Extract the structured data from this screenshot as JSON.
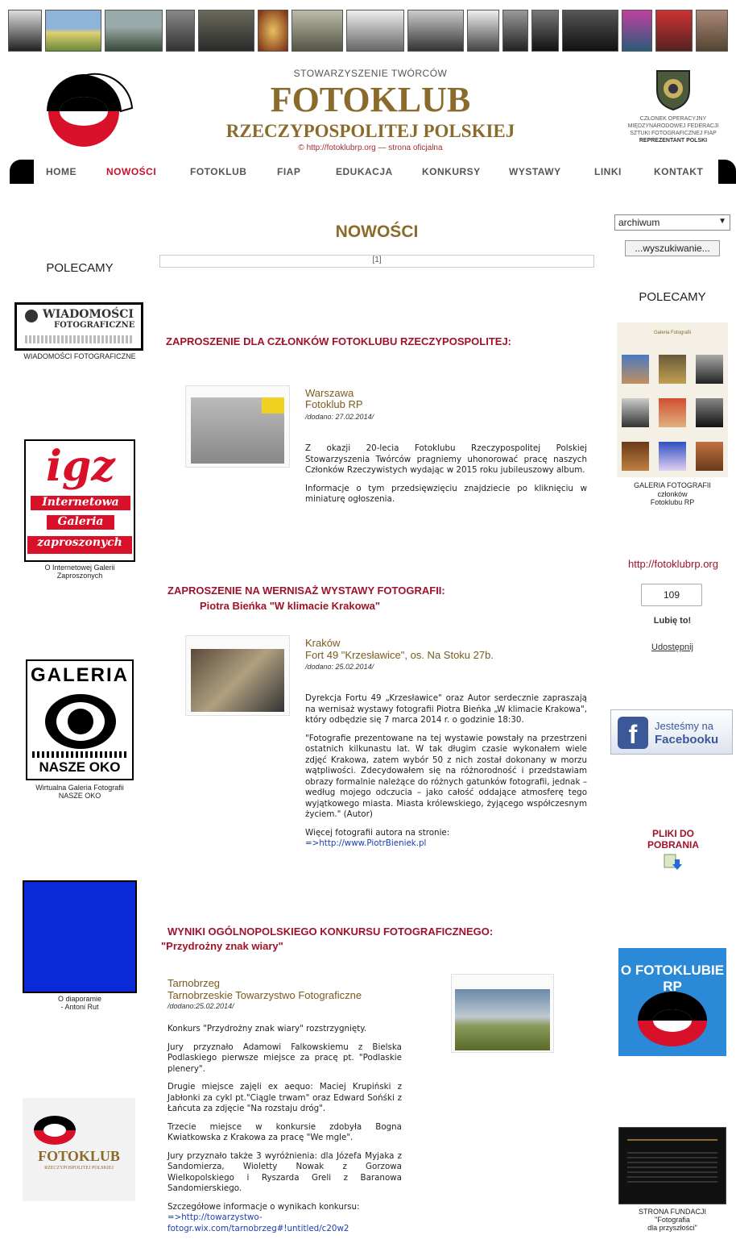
{
  "header": {
    "subtitle": "STOWARZYSZENIE TWÓRCÓW",
    "title": "FOTOKLUB",
    "title2": "RZECZYPOSPOLITEJ POLSKIEJ",
    "url_note": "© http://fotoklubrp.org — strona oficjalna",
    "fiap_line1": "CZŁONEK OPERACYJNY",
    "fiap_line2": "MIĘDZYNARODOWEJ FEDERACJI",
    "fiap_line3": "SZTUKI FOTOGRAFICZNEJ FIAP",
    "fiap_line4": "REPREZENTANT POLSKI"
  },
  "nav": {
    "items": [
      "HOME",
      "NOWOŚCI",
      "FOTOKLUB",
      "FIAP",
      "EDUKACJA",
      "KONKURSY",
      "WYSTAWY",
      "LINKI",
      "KONTAKT"
    ],
    "active": "NOWOŚCI"
  },
  "controls": {
    "archive_select": "archiwum",
    "search_button": "...wyszukiwanie..."
  },
  "main": {
    "section_title": "NOWOŚCI",
    "pager": "[1]"
  },
  "left_sidebar": {
    "heading": "POLECAMY",
    "banner1_text1": "WIADOMOŚCI",
    "banner1_text2": "FOTOGRAFICZNE",
    "banner1_caption": "WIADOMOŚCI FOTOGRAFICZNE",
    "banner2_big": "igz",
    "banner2_line1": "Internetowa",
    "banner2_line2": "Galeria",
    "banner2_line3": "zaproszonych",
    "banner2_caption1": "O Internetowej Galerii",
    "banner2_caption2": "Zaproszonych",
    "banner3_top": "GALERIA",
    "banner3_bottom": "NASZE OKO",
    "banner3_caption1": "Wirtualna Galeria Fotografii",
    "banner3_caption2": "NASZE OKO",
    "banner4_caption1": "O diaporamie",
    "banner4_caption2": "- Antoni Rut",
    "banner5_text": "FOTOKLUB",
    "banner5_sub": "RZECZYPOSPOLITEJ POLSKIEJ"
  },
  "right_sidebar": {
    "heading": "POLECAMY",
    "gallery_title": "Galeria Fotografii",
    "gallery_caption1": "GALERIA FOTOGRAFII",
    "gallery_caption2": "członków",
    "gallery_caption3": "Fotoklubu RP",
    "site_url": "http://fotoklubrp.org",
    "like_count": "109",
    "like_label": "Lubię to!",
    "share_label": "Udostępnij",
    "facebook_line1": "Jesteśmy na",
    "facebook_line2": "Facebooku",
    "downloads_line1": "PLIKI DO",
    "downloads_line2": "POBRANIA",
    "about_banner": "O FOTOKLUBIE RP",
    "foundation_caption1": "STRONA FUNDACJI",
    "foundation_caption2": "\"Fotografia",
    "foundation_caption3": "dla przyszłości\""
  },
  "articles": [
    {
      "heading": "ZAPROSZENIE DLA CZŁONKÓW FOTOKLUBU RZECZYPOSPOLITEJ:",
      "location": "Warszawa",
      "org": "Fotoklub RP",
      "date": "/dodano: 27.02.2014/",
      "p1": "Z okazji 20-lecia Fotoklubu Rzeczypospolitej Polskiej Stowarzyszenia Twórców pragniemy uhonorować pracę naszych Członków Rzeczywistych wydając w 2015 roku jubileuszowy album.",
      "p2": "Informacje o tym przedsięwzięciu znajdziecie po kliknięciu w miniaturę ogłoszenia."
    },
    {
      "heading": "ZAPROSZENIE NA WERNISAŻ WYSTAWY FOTOGRAFII:",
      "subheading": "Piotra Bieńka \"W klimacie Krakowa\"",
      "location": "Kraków",
      "org": "Fort 49 \"Krzesławice\", os. Na Stoku 27b.",
      "date": "/dodano: 25.02.2014/",
      "p1": "Dyrekcja Fortu 49 „Krzesławice\" oraz Autor serdecznie zapraszają na wernisaż wystawy fotografii Piotra Bieńka „W klimacie Krakowa\", który odbędzie się 7 marca 2014 r. o godzinie 18:30.",
      "p2": "\"Fotografie prezentowane na tej wystawie powstały na przestrzeni ostatnich kilkunastu lat. W tak długim czasie wykonałem wiele zdjęć Krakowa, zatem wybór 50 z nich został dokonany w morzu wątpliwości. Zdecydowałem się na różnorodność i przedstawiam obrazy formalnie należące do różnych gatunków fotografii, jednak – według mojego odczucia – jako całość oddające atmosferę tego wyjątkowego miasta. Miasta królewskiego, żyjącego współczesnym życiem.\" (Autor)",
      "p3": "Więcej fotografii autora na stronie:",
      "link": "=>http://www.PiotrBieniek.pl"
    },
    {
      "heading": "WYNIKI OGÓLNOPOLSKIEGO KONKURSU FOTOGRAFICZNEGO:",
      "subheading": "\"Przydrożny znak wiary\"",
      "location": "Tarnobrzeg",
      "org": "Tarnobrzeskie Towarzystwo Fotograficzne",
      "date": "/dodano:25.02.2014/",
      "p1": "Konkurs \"Przydrożny znak wiary\" rozstrzygnięty.",
      "p2": "Jury przyznało Adamowi Falkowskiemu z Bielska Podlaskiego pierwsze miejsce za pracę pt. \"Podlaskie plenery\".",
      "p3": "Drugie miejsce zajęli ex aequo: Maciej Krupiński z Jabłonki za cykl pt.\"Ciągle trwam\" oraz Edward Sońśki z Łańcuta za zdjęcie \"Na rozstaju dróg\".",
      "p4": "Trzecie miejsce w konkursie zdobyła Bogna Kwiatkowska z Krakowa za pracę \"We mgle\".",
      "p5": "Jury przyznało także 3 wyróżnienia: dla Józefa Myjaka z Sandomierza, Wioletty Nowak z Gorzowa Wielkopolskiego i Ryszarda Greli z Baranowa Sandomierskiego.",
      "p6": "Szczegółowe informacje o wynikach konkursu:",
      "link1": "=>http://towarzystwo-",
      "link2": "fotogr.wix.com/tarnobrzeg#!untitled/c20w2"
    }
  ]
}
